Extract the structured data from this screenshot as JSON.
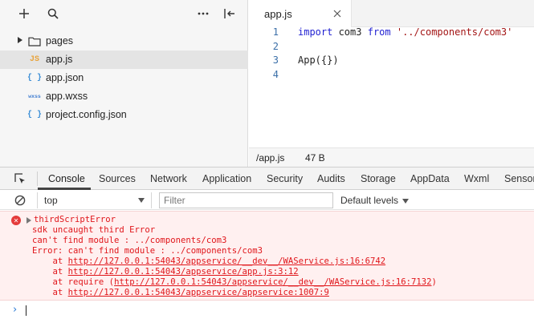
{
  "explorer": {
    "toolbar": {
      "add_icon": "plus-icon",
      "search_icon": "search-icon",
      "more_icon": "ellipsis-icon",
      "collapse_icon": "collapse-sidebar-icon"
    },
    "items": [
      {
        "name": "pages",
        "type": "folder",
        "icon": "folder-icon"
      },
      {
        "name": "app.js",
        "type": "js",
        "badge": "JS",
        "active": true
      },
      {
        "name": "app.json",
        "type": "json",
        "badge": "{ }"
      },
      {
        "name": "app.wxss",
        "type": "wxss",
        "badge": "wxss"
      },
      {
        "name": "project.config.json",
        "type": "json",
        "badge": "{ }"
      }
    ]
  },
  "editor": {
    "tab": {
      "label": "app.js",
      "close_icon": "close-icon"
    },
    "lines": [
      {
        "num": "1",
        "kw1": "import",
        "mid": " com3 ",
        "kw2": "from",
        "sp": " ",
        "str": "'../components/com3'"
      },
      {
        "num": "2",
        "text": ""
      },
      {
        "num": "3",
        "text": "App({})"
      },
      {
        "num": "4",
        "text": ""
      }
    ],
    "status": {
      "path": "/app.js",
      "size": "47 B"
    }
  },
  "devtools": {
    "inspect_icon": "inspect-element-icon",
    "tabs": [
      "Console",
      "Sources",
      "Network",
      "Application",
      "Security",
      "Audits",
      "Storage",
      "AppData",
      "Wxml",
      "Sensor"
    ],
    "active_tab": "Console",
    "console_bar": {
      "clear_icon": "clear-console-icon",
      "context": "top",
      "filter_placeholder": "Filter",
      "levels": "Default levels"
    },
    "error": {
      "header": "thirdScriptError",
      "lines": [
        "sdk uncaught third Error",
        "can't find module : ../components/com3",
        "Error: can't find module : ../components/com3"
      ],
      "stack": [
        {
          "prefix": "    at ",
          "link": "http://127.0.0.1:54043/appservice/__dev__/WAService.js:16:6742",
          "suffix": ""
        },
        {
          "prefix": "    at ",
          "link": "http://127.0.0.1:54043/appservice/app.js:3:12",
          "suffix": ""
        },
        {
          "prefix": "    at require (",
          "link": "http://127.0.0.1:54043/appservice/__dev__/WAService.js:16:7132",
          "suffix": ")"
        },
        {
          "prefix": "    at ",
          "link": "http://127.0.0.1:54043/appservice/appservice:1007:9",
          "suffix": ""
        }
      ]
    },
    "prompt_icon": "chevron-right-icon"
  },
  "colors": {
    "error_text": "#e0161b",
    "error_bg": "#fff0f0",
    "keyword": "#1f1fd1",
    "string": "#a31515",
    "line_number": "#3b6fa8"
  }
}
